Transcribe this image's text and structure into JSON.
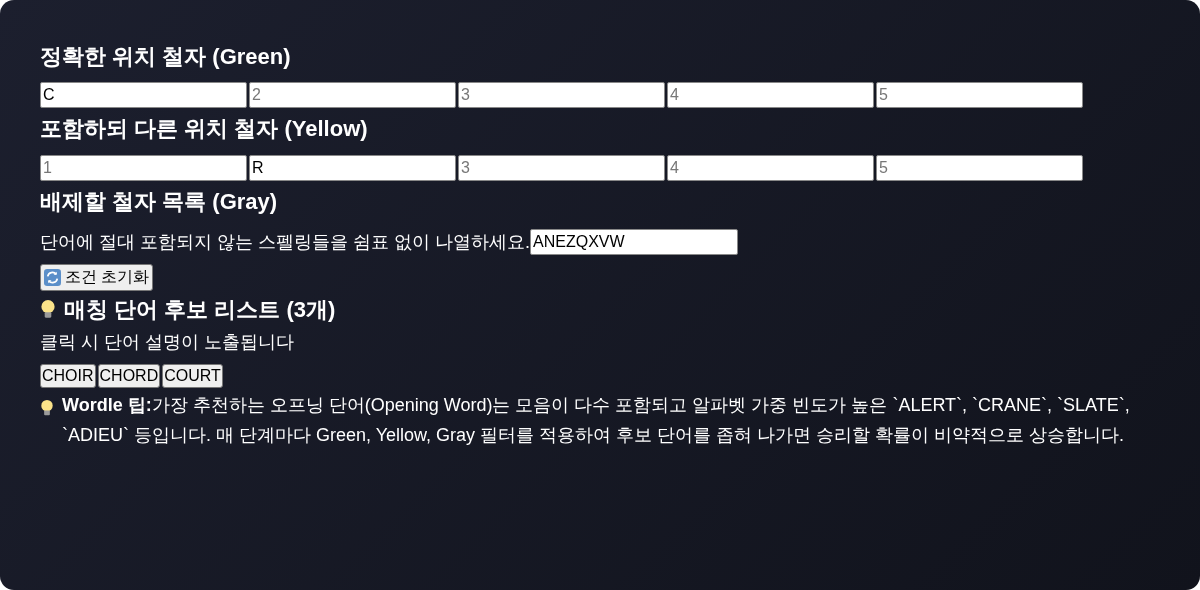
{
  "green": {
    "heading": "정확한 위치 철자 (Green)",
    "slots": [
      {
        "value": "C"
      },
      {
        "placeholder": "2"
      },
      {
        "placeholder": "3"
      },
      {
        "placeholder": "4"
      },
      {
        "placeholder": "5"
      }
    ]
  },
  "yellow": {
    "heading": "포함하되 다른 위치 철자 (Yellow)",
    "slots": [
      {
        "placeholder": "1"
      },
      {
        "value": "R"
      },
      {
        "placeholder": "3"
      },
      {
        "placeholder": "4"
      },
      {
        "placeholder": "5"
      }
    ]
  },
  "gray": {
    "heading": "배제할 철자 목록 (Gray)",
    "label": "단어에 절대 포함되지 않는 스펠링들을 쉼표 없이 나열하세요.",
    "value": "ANEZQXVW"
  },
  "reset_button": "조건 초기화",
  "candidates": {
    "heading": "매칭 단어 후보 리스트 (3개)",
    "hint": "클릭 시 단어 설명이 노출됩니다",
    "words": [
      "CHOIR",
      "CHORD",
      "COURT"
    ]
  },
  "tip": "**Wordle 팁:**가장 추천하는 오프닝 단어(Opening Word)는 모음이 다수 포함되고 알파벳 가중 빈도가 높은 `ALERT`, `CRANE`, `SLATE`, `ADIEU` 등입니다. 매 단계마다 Green, Yellow, Gray 필터를 적용하여 후보 단어를 좁혀 나가면 승리할 확률이 비약적으로 상승합니다."
}
